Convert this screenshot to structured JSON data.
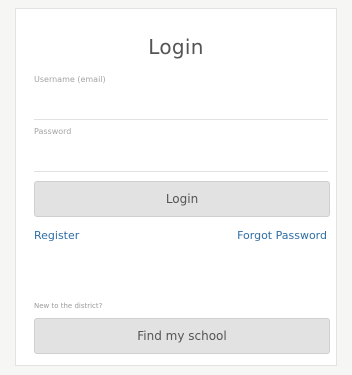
{
  "login_form": {
    "title": "Login",
    "username_label": "Username (email)",
    "password_label": "Password",
    "login_button": "Login",
    "register_link": "Register",
    "forgot_password_link": "Forgot Password",
    "new_user_hint": "New to the district?",
    "find_school_button": "Find my school"
  }
}
